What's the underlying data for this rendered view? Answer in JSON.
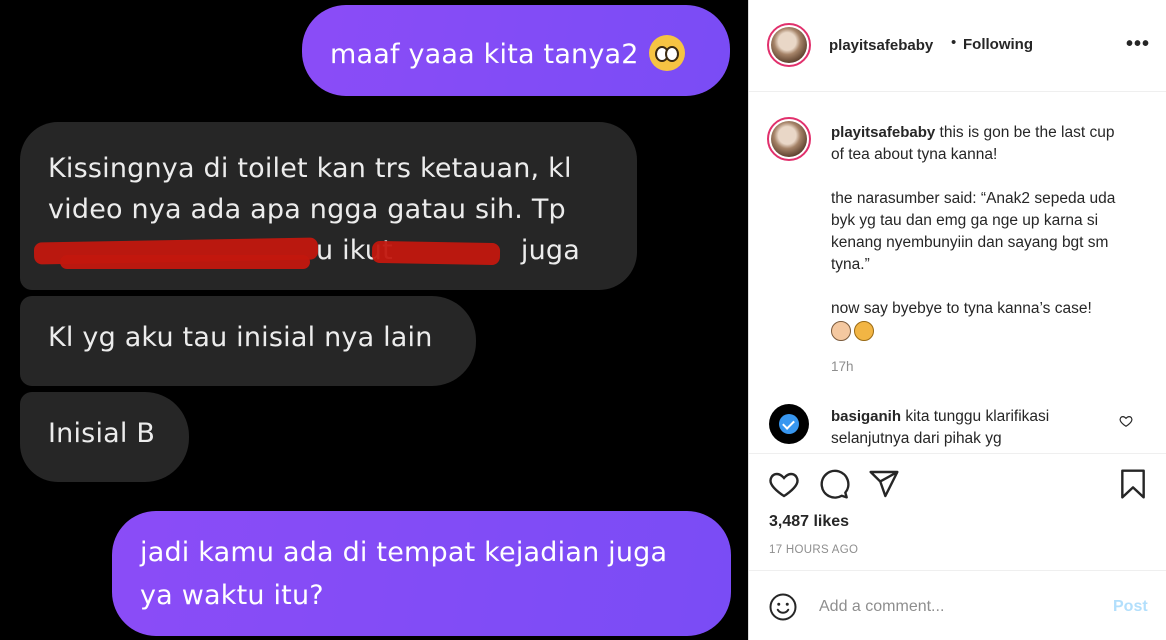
{
  "chat": {
    "msg1": "maaf yaaa kita tanya2",
    "msg2_line1": "Kissingnya di toilet kan trs ketauan, kl",
    "msg2_line2": "video nya ada apa ngga gatau sih. Tp",
    "msg2_line3a": "u ikut",
    "msg2_line3b": "juga",
    "msg3": "Kl yg aku tau inisial nya lain",
    "msg4": "Inisial B",
    "msg5": "jadi kamu ada di tempat kejadian juga ya waktu itu?"
  },
  "header": {
    "username": "playitsafebaby",
    "separator": "•",
    "follow_label": "Following",
    "more_label": "•••"
  },
  "caption": {
    "username": "playitsafebaby",
    "text1": "this is gon be the last cup of tea about tyna kanna!",
    "text2": "the narasumber said: “Anak2 sepeda uda byk yg tau dan emg ga nge up karna si kenang nyembunyiin dan sayang bgt sm tyna.”",
    "text3": "now say byebye to tyna kanna’s case!",
    "time": "17h"
  },
  "comment": {
    "username": "basiganih",
    "text": "kita tunggu klarifikasi selanjutnya dari pihak yg"
  },
  "actions": {
    "likes": "3,487 likes",
    "ago": "17 HOURS AGO"
  },
  "add_comment": {
    "placeholder": "Add a comment...",
    "post_label": "Post"
  },
  "colors": {
    "outgoing_bubble": "#8b4cf7",
    "incoming_bubble": "#262626",
    "redaction": "#c2170e",
    "story_ring": "#e1306c",
    "verified": "#3897f0",
    "post_disabled": "#b2dffc"
  }
}
